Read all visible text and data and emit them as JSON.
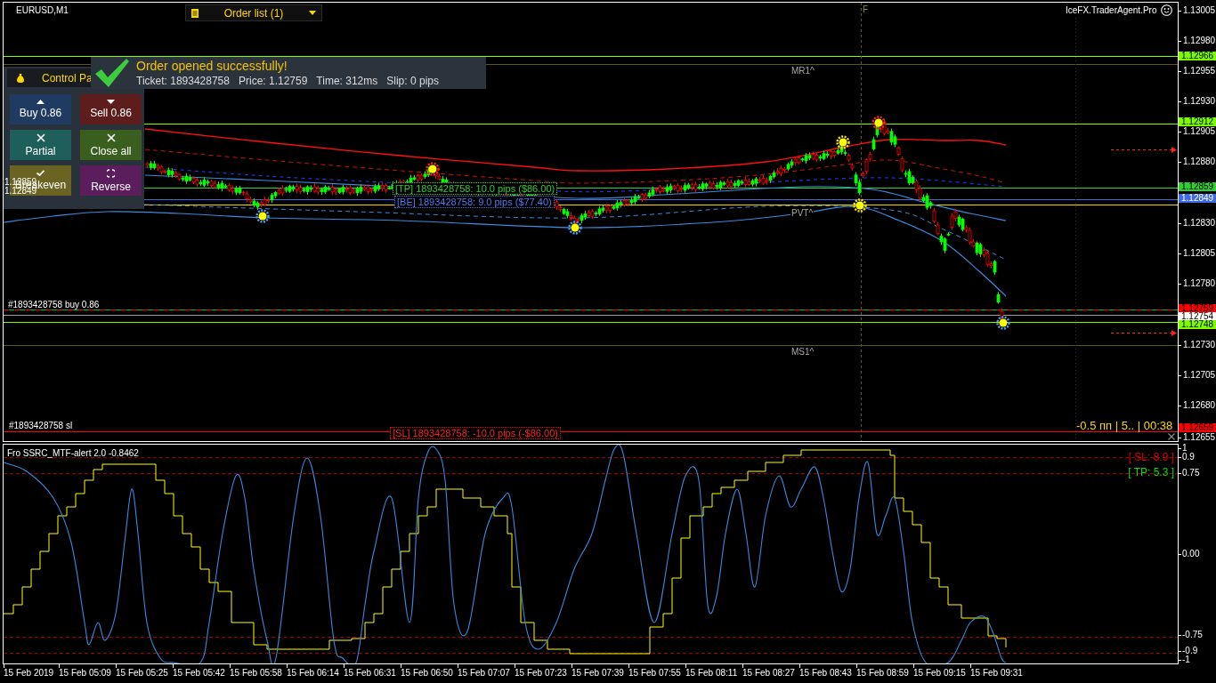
{
  "chart": {
    "symbol": "EURUSD,M1",
    "marker_f": "F",
    "brand": "IceFX.TraderAgent.Pro",
    "pivot_labels": [
      "MR1^",
      "PVT^",
      "MS1^"
    ],
    "price_labels": [
      "1.12859",
      "1.12849"
    ],
    "order_labels": [
      {
        "text": "[TP] 1893428758: 10.0 pips ($86.00)",
        "kind": "tp"
      },
      {
        "text": "[BE] 1893428758: 9.0 pips ($77.40)",
        "kind": "be"
      },
      {
        "text": "#1893428758 buy 0.86",
        "kind": "order"
      },
      {
        "text": "#1893428758 sl",
        "kind": "order_sl"
      },
      {
        "text": "[SL] 1893428758: -10.0 pips (-$86.00)",
        "kind": "sl"
      }
    ],
    "countdown": "-0.5 пп | 5.. | 00:38"
  },
  "order_list": {
    "label": "Order list (1)"
  },
  "notification": {
    "title": "Order opened successfully!",
    "details": [
      "Ticket: 1893428758",
      "Price: 1.12759",
      "Time: 312ms",
      "Slip: 0 pips"
    ]
  },
  "control_panel": {
    "title": "Control Pa",
    "buttons": [
      {
        "label": "Buy 0.86",
        "kind": "buy"
      },
      {
        "label": "Sell 0.86",
        "kind": "sell"
      },
      {
        "label": "Partial",
        "kind": "partial"
      },
      {
        "label": "Close all",
        "kind": "close_all"
      },
      {
        "label": "Breakeven",
        "kind": "breakeven"
      },
      {
        "label": "Reverse",
        "kind": "reverse"
      }
    ]
  },
  "price_axis": {
    "ticks": [
      "1.13005",
      "1.12980",
      "1.12955",
      "1.12930",
      "1.12905",
      "1.12880",
      "1.12830",
      "1.12805",
      "1.12780",
      "1.12730",
      "1.12705",
      "1.12680",
      "1.12655"
    ],
    "markers": [
      {
        "text": "1.12966",
        "color": "#7cfc00"
      },
      {
        "text": "1.12912",
        "color": "#7cfc00"
      },
      {
        "text": "1.12859",
        "color": "#32cd32"
      },
      {
        "text": "1.12849",
        "color": "#4169e1"
      },
      {
        "text": "1.12759",
        "color": "#ff0000"
      },
      {
        "text": "1.12754",
        "color": "#ffffff"
      },
      {
        "text": "1.12748",
        "color": "#7cfc00"
      },
      {
        "text": "1.12659",
        "color": "#ff0000"
      }
    ]
  },
  "indicator": {
    "title": "Fro SSRC_MTF-alert 2.0 -0.8462",
    "signals": [
      {
        "text": "[ SL: 8.9 ]",
        "kind": "sl"
      },
      {
        "text": "[ TP: 5.3 ]",
        "kind": "tp"
      }
    ],
    "axis_labels": [
      "1",
      "0.9",
      "0.75",
      "0.00",
      "-0.75",
      "-0.9",
      "-1"
    ]
  },
  "time_axis": {
    "labels": [
      "15 Feb 2019",
      "15 Feb 05:09",
      "15 Feb 05:25",
      "15 Feb 05:42",
      "15 Feb 05:58",
      "15 Feb 06:14",
      "15 Feb 06:31",
      "15 Feb 06:50",
      "15 Feb 07:07",
      "15 Feb 07:23",
      "15 Feb 07:39",
      "15 Feb 07:55",
      "15 Feb 08:11",
      "15 Feb 08:27",
      "15 Feb 08:43",
      "15 Feb 08:59",
      "15 Feb 09:15",
      "15 Feb 09:31"
    ]
  }
}
